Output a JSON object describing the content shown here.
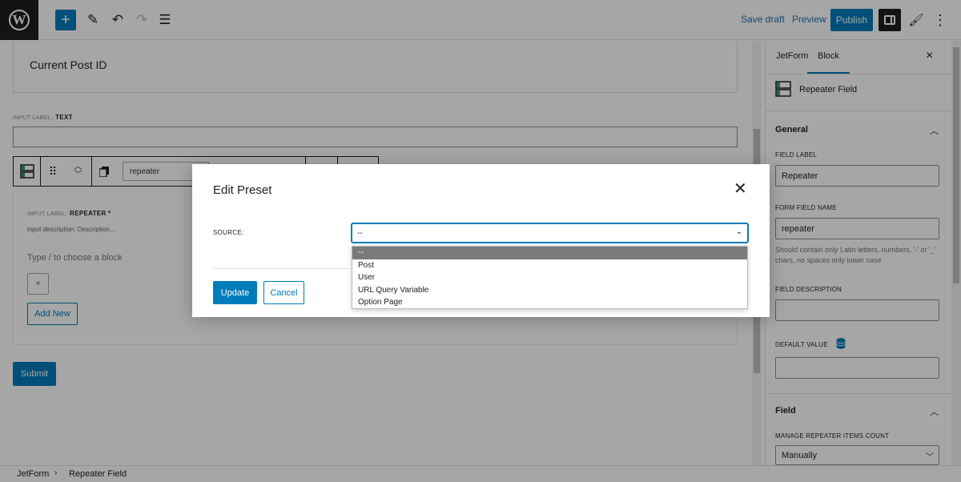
{
  "toolbar": {
    "logo": "W",
    "save_draft": "Save draft",
    "preview": "Preview",
    "publish": "Publish"
  },
  "canvas": {
    "current_post_label": "Current Post ID",
    "text_field": {
      "prefix": "INPUT LABEL:",
      "label": "TEXT"
    },
    "repeater_input_value": "repeater",
    "repeater_field": {
      "prefix": "INPUT LABEL:",
      "label": "REPEATER *",
      "description": "input description:   Description...",
      "placeholder": "Type / to choose a block",
      "remove_symbol": "×",
      "add_new": "Add New"
    },
    "submit": "Submit"
  },
  "sidebar": {
    "tabs": [
      "JetForm",
      "Block"
    ],
    "active_tab": "Block",
    "block_name": "Repeater Field",
    "general_section": "General",
    "field_label_title": "FIELD LABEL",
    "field_label_value": "Repeater",
    "form_field_name_title": "FORM FIELD NAME",
    "form_field_name_value": "repeater",
    "form_field_name_help": "Should contain only Latin letters, numbers, '-' or '_' chars, no spaces only lower case",
    "field_description_title": "FIELD DESCRIPTION",
    "default_value_title": "DEFAULT VALUE",
    "field_section": "Field",
    "manage_items_title": "MANAGE REPEATER ITEMS COUNT",
    "manage_items_value": "Manually"
  },
  "footer": {
    "breadcrumb": [
      "JetForm",
      "Repeater Field"
    ]
  },
  "modal": {
    "title": "Edit Preset",
    "source_label": "SOURCE:",
    "source_value": "--",
    "options": [
      "--",
      "Post",
      "User",
      "URL Query Variable",
      "Option Page"
    ],
    "update": "Update",
    "cancel": "Cancel"
  },
  "colors": {
    "accent": "#007cba",
    "dark": "#1e1e1e",
    "overlay": "rgba(0,0,0,0.35)"
  }
}
